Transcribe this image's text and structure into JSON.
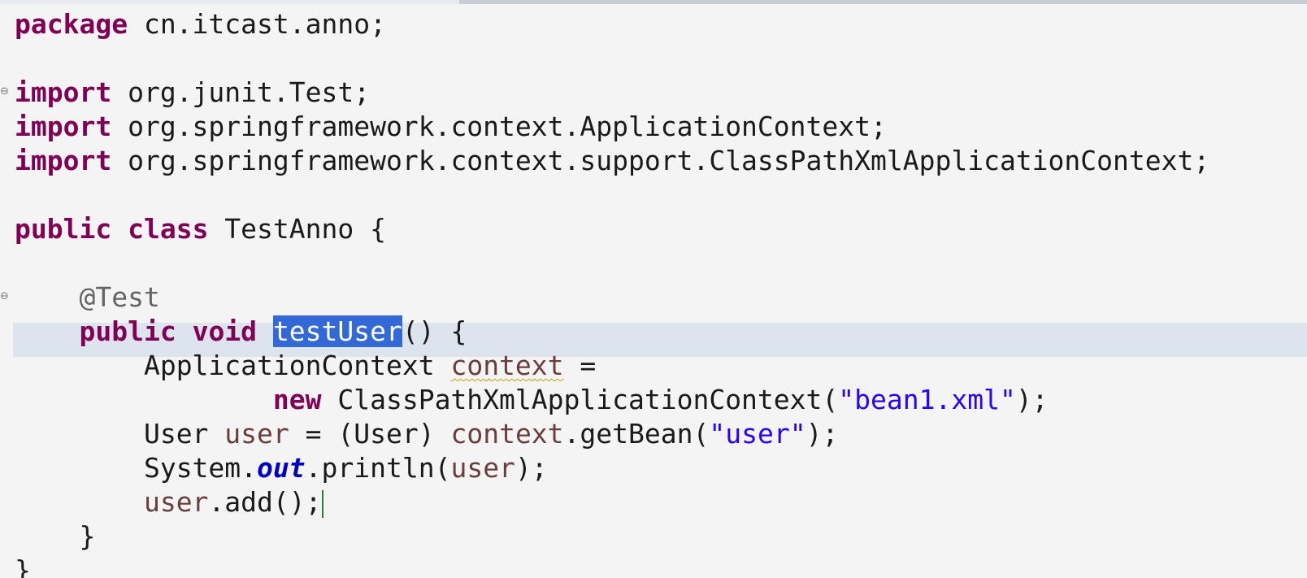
{
  "editor": {
    "language": "java",
    "colors": {
      "keyword": "#7f0055",
      "string": "#2a00ff",
      "annotation": "#646464",
      "local_variable": "#6a3e3e",
      "static_field": "#0000c0",
      "selection": "#3369d6",
      "current_line": "#dde4ee",
      "background": "#f4f4f4"
    },
    "fold_icon": "collapse-minus-icon",
    "lines": {
      "l1": {
        "kw": "package",
        "rest": " cn.itcast.anno;"
      },
      "l3": {
        "kw": "import",
        "rest": " org.junit.Test;"
      },
      "l4": {
        "kw": "import",
        "rest": " org.springframework.context.ApplicationContext;"
      },
      "l5": {
        "kw": "import",
        "rest": " org.springframework.context.support.ClassPathXmlApplicationContext;"
      },
      "l7": {
        "kw1": "public",
        "kw2": "class",
        "rest": " TestAnno {"
      },
      "l9": {
        "annotation": "@Test"
      },
      "l10": {
        "kw1": "public",
        "kw2": "void",
        "selected": "testUser",
        "rest": "() {"
      },
      "l11": {
        "type": "ApplicationContext ",
        "var": "context",
        "rest": " ="
      },
      "l12": {
        "kw": "new",
        "rest": " ClassPathXmlApplicationContext(",
        "str": "\"bean1.xml\"",
        "end": ");"
      },
      "l13": {
        "type": "User ",
        "var": "user",
        "mid": " = (User) ",
        "var2": "context",
        "call": ".getBean(",
        "str": "\"user\"",
        "end": ");"
      },
      "l14": {
        "cls": "System.",
        "field": "out",
        "call": ".println(",
        "var": "user",
        "end": ");"
      },
      "l15": {
        "var": "user",
        "rest": ".add();"
      },
      "l16": {
        "text": "}"
      },
      "l17": {
        "text": "}"
      }
    }
  }
}
